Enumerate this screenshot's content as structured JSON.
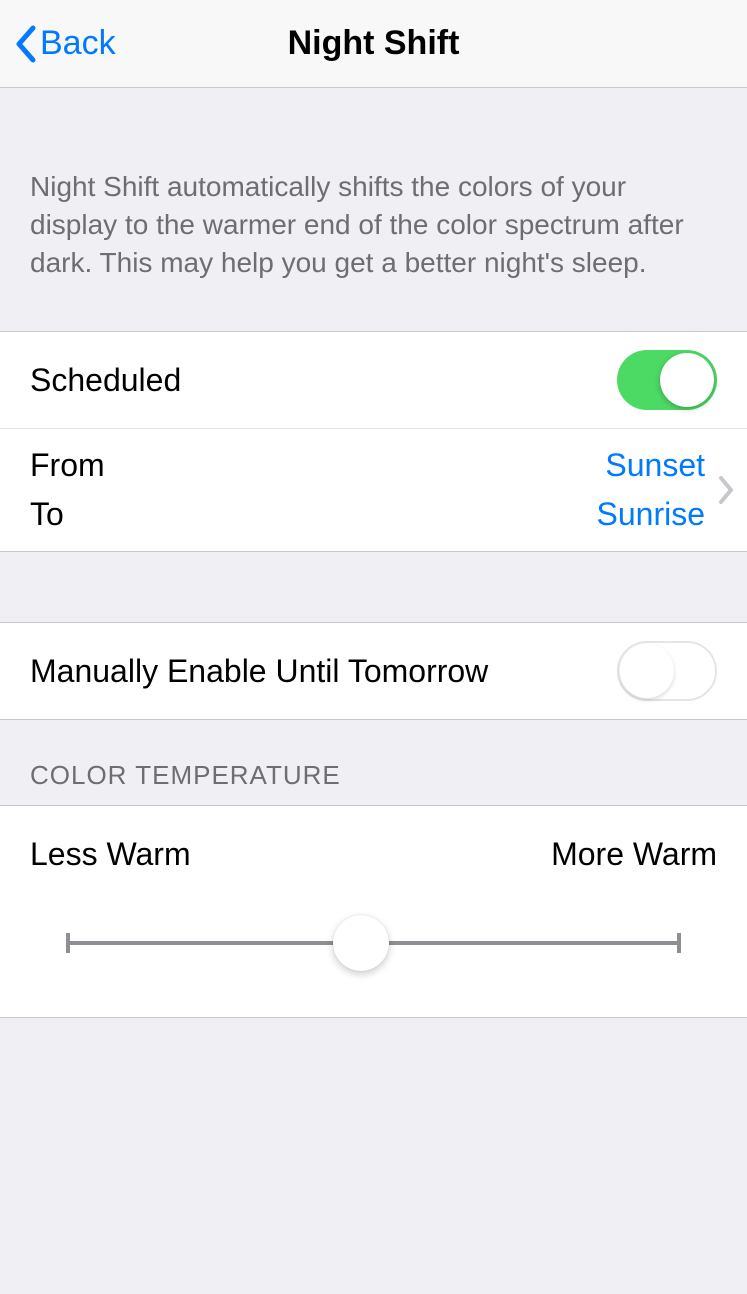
{
  "nav": {
    "back_label": "Back",
    "title": "Night Shift"
  },
  "intro": {
    "text": "Night Shift automatically shifts the colors of your display to the warmer end of the color spectrum after dark. This may help you get a better night's sleep."
  },
  "schedule": {
    "scheduled_label": "Scheduled",
    "scheduled_on": true,
    "from_label": "From",
    "to_label": "To",
    "from_value": "Sunset",
    "to_value": "Sunrise"
  },
  "manual": {
    "label": "Manually Enable Until Tomorrow",
    "on": false
  },
  "temperature": {
    "header": "COLOR TEMPERATURE",
    "left_label": "Less Warm",
    "right_label": "More Warm",
    "value_percent": 48
  }
}
